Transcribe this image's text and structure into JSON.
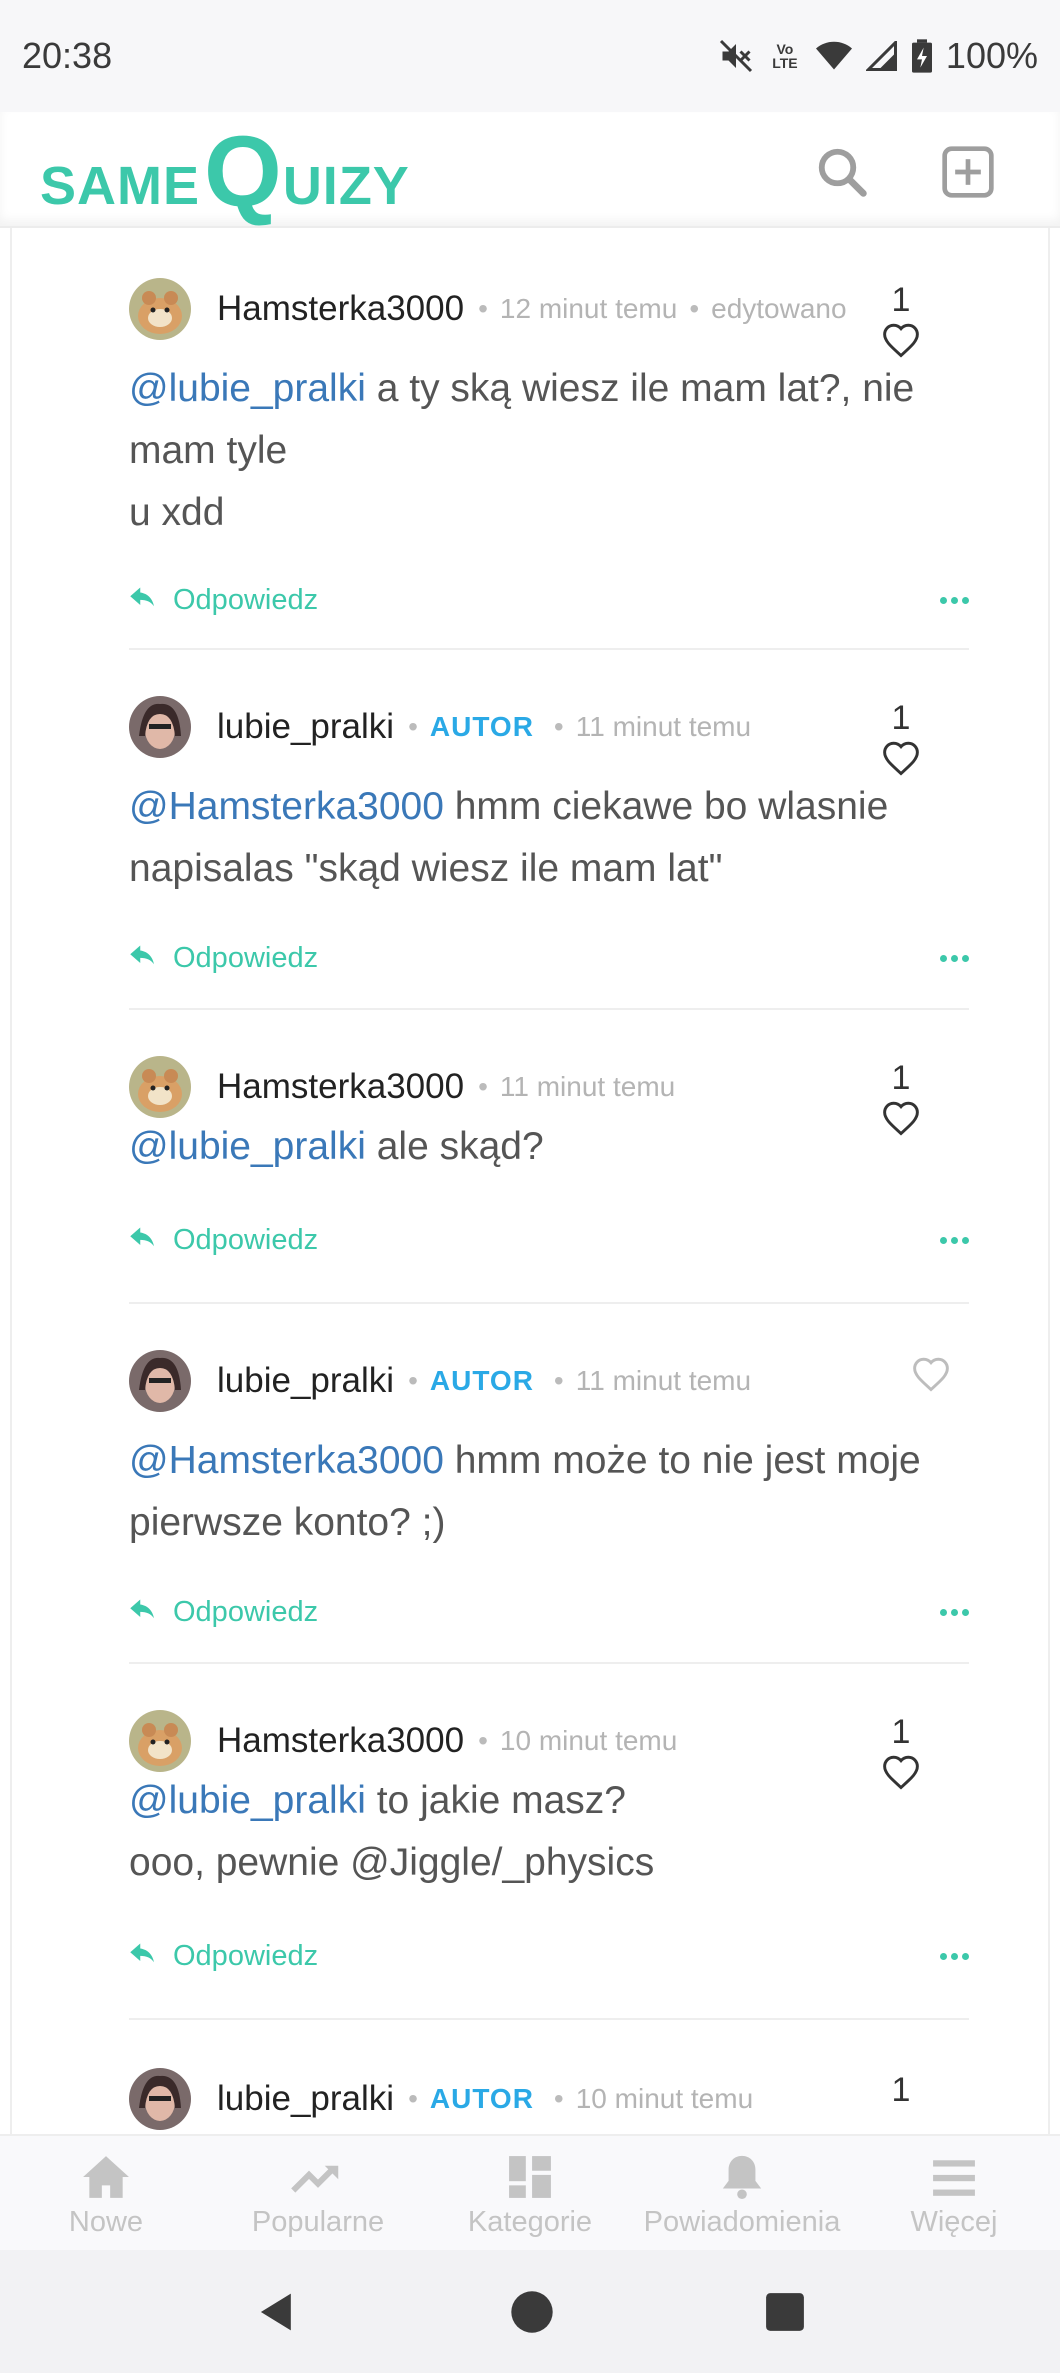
{
  "status_bar": {
    "time": "20:38",
    "battery": "100%",
    "network_label": "Vo LTE"
  },
  "app": {
    "logo_same": "SAME",
    "logo_q": "Q",
    "logo_uizy": "UIZY",
    "brand_color": "#3cc8aa"
  },
  "comments": [
    {
      "user": "Hamsterka3000",
      "avatar": "hamster",
      "badge": "",
      "time": "12 minut temu",
      "edited": "edytowano",
      "likes": "1",
      "mention": "@lubie_pralki",
      "text": " a ty ską wiesz ile mam lat?, nie mam tyle",
      "text2": "u xdd",
      "reply": "Odpowiedz"
    },
    {
      "user": "lubie_pralki",
      "avatar": "person",
      "badge": "AUTOR",
      "time": "11 minut temu",
      "edited": "",
      "likes": "1",
      "mention": "@Hamsterka3000",
      "text": " hmm ciekawe bo wlasnie napisalas \"skąd wiesz ile mam lat\"",
      "text2": "",
      "reply": "Odpowiedz"
    },
    {
      "user": "Hamsterka3000",
      "avatar": "hamster",
      "badge": "",
      "time": "11 minut temu",
      "edited": "",
      "likes": "1",
      "mention": "@lubie_pralki",
      "text": " ale skąd?",
      "text2": "",
      "reply": "Odpowiedz"
    },
    {
      "user": "lubie_pralki",
      "avatar": "person",
      "badge": "AUTOR",
      "time": "11 minut temu",
      "edited": "",
      "likes": "",
      "mention": "@Hamsterka3000",
      "text": " hmm może to nie jest moje pierwsze konto? ;)",
      "text2": "",
      "reply": "Odpowiedz"
    },
    {
      "user": "Hamsterka3000",
      "avatar": "hamster",
      "badge": "",
      "time": "10 minut temu",
      "edited": "",
      "likes": "1",
      "mention": "@lubie_pralki",
      "text": " to jakie masz?",
      "text2": "ooo, pewnie @Jiggle/_physics",
      "reply": "Odpowiedz"
    },
    {
      "user": "lubie_pralki",
      "avatar": "person",
      "badge": "AUTOR",
      "time": "10 minut temu",
      "edited": "",
      "likes": "1"
    }
  ],
  "bottom_nav": [
    {
      "label": "Nowe",
      "icon": "home-icon"
    },
    {
      "label": "Popularne",
      "icon": "trending-icon"
    },
    {
      "label": "Kategorie",
      "icon": "grid-icon"
    },
    {
      "label": "Powiadomienia",
      "icon": "bell-icon"
    },
    {
      "label": "Więcej",
      "icon": "menu-icon"
    }
  ]
}
